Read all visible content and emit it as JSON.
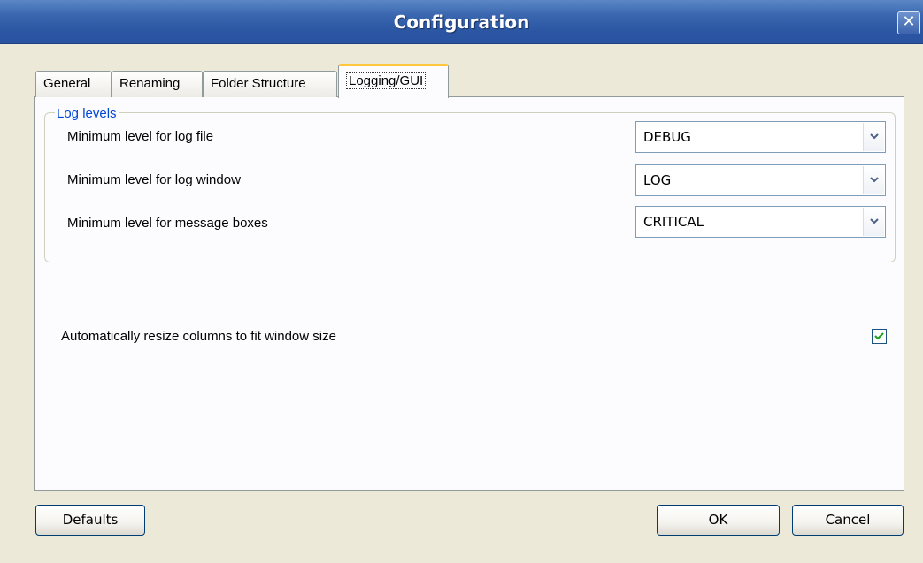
{
  "window": {
    "title": "Configuration",
    "close_glyph": "✕"
  },
  "tabs": [
    {
      "label": "General"
    },
    {
      "label": "Renaming"
    },
    {
      "label": "Folder Structure"
    },
    {
      "label": "Logging/GUI",
      "active": true
    }
  ],
  "log_levels": {
    "legend": "Log levels",
    "rows": [
      {
        "label": "Minimum level for log file",
        "value": "DEBUG"
      },
      {
        "label": "Minimum level for log window",
        "value": "LOG"
      },
      {
        "label": "Minimum level for message boxes",
        "value": "CRITICAL"
      }
    ]
  },
  "auto_resize": {
    "label": "Automatically resize columns to fit window size",
    "checked": true
  },
  "buttons": {
    "defaults": "Defaults",
    "ok": "OK",
    "cancel": "Cancel"
  },
  "colors": {
    "title_bar": "#3a66b0",
    "legend": "#0046d5",
    "active_tab_accent": "#ffc83c"
  }
}
